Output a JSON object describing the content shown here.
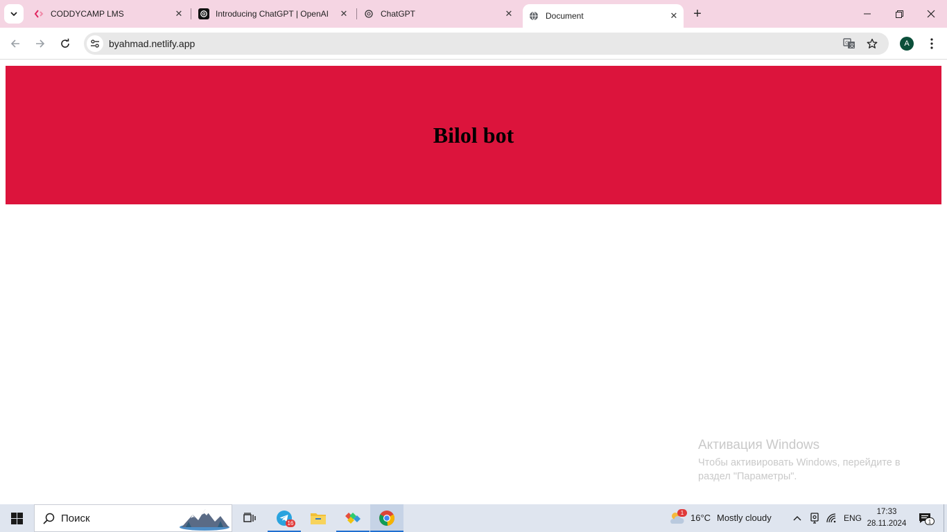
{
  "browser": {
    "tabs": [
      {
        "title": "CODDYCAMP LMS",
        "icon": "coddycamp-favicon",
        "active": false
      },
      {
        "title": "Introducing ChatGPT | OpenAI",
        "icon": "openai-favicon",
        "active": false
      },
      {
        "title": "ChatGPT",
        "icon": "chatgpt-favicon",
        "active": false
      },
      {
        "title": "Document",
        "icon": "globe-favicon",
        "active": true
      }
    ],
    "url": "byahmad.netlify.app",
    "profile_initial": "A"
  },
  "page": {
    "heading": "Bilol bot",
    "hero_color": "#dc143c"
  },
  "watermark": {
    "title": "Активация Windows",
    "text": "Чтобы активировать Windows, перейдите в раздел \"Параметры\"."
  },
  "taskbar": {
    "search_placeholder": "Поиск",
    "telegram_badge": "16",
    "weather": {
      "temp": "16°C",
      "condition": "Mostly cloudy",
      "alert_count": "1"
    },
    "language": "ENG",
    "time": "17:33",
    "date": "28.11.2024",
    "notification_count": "1"
  }
}
